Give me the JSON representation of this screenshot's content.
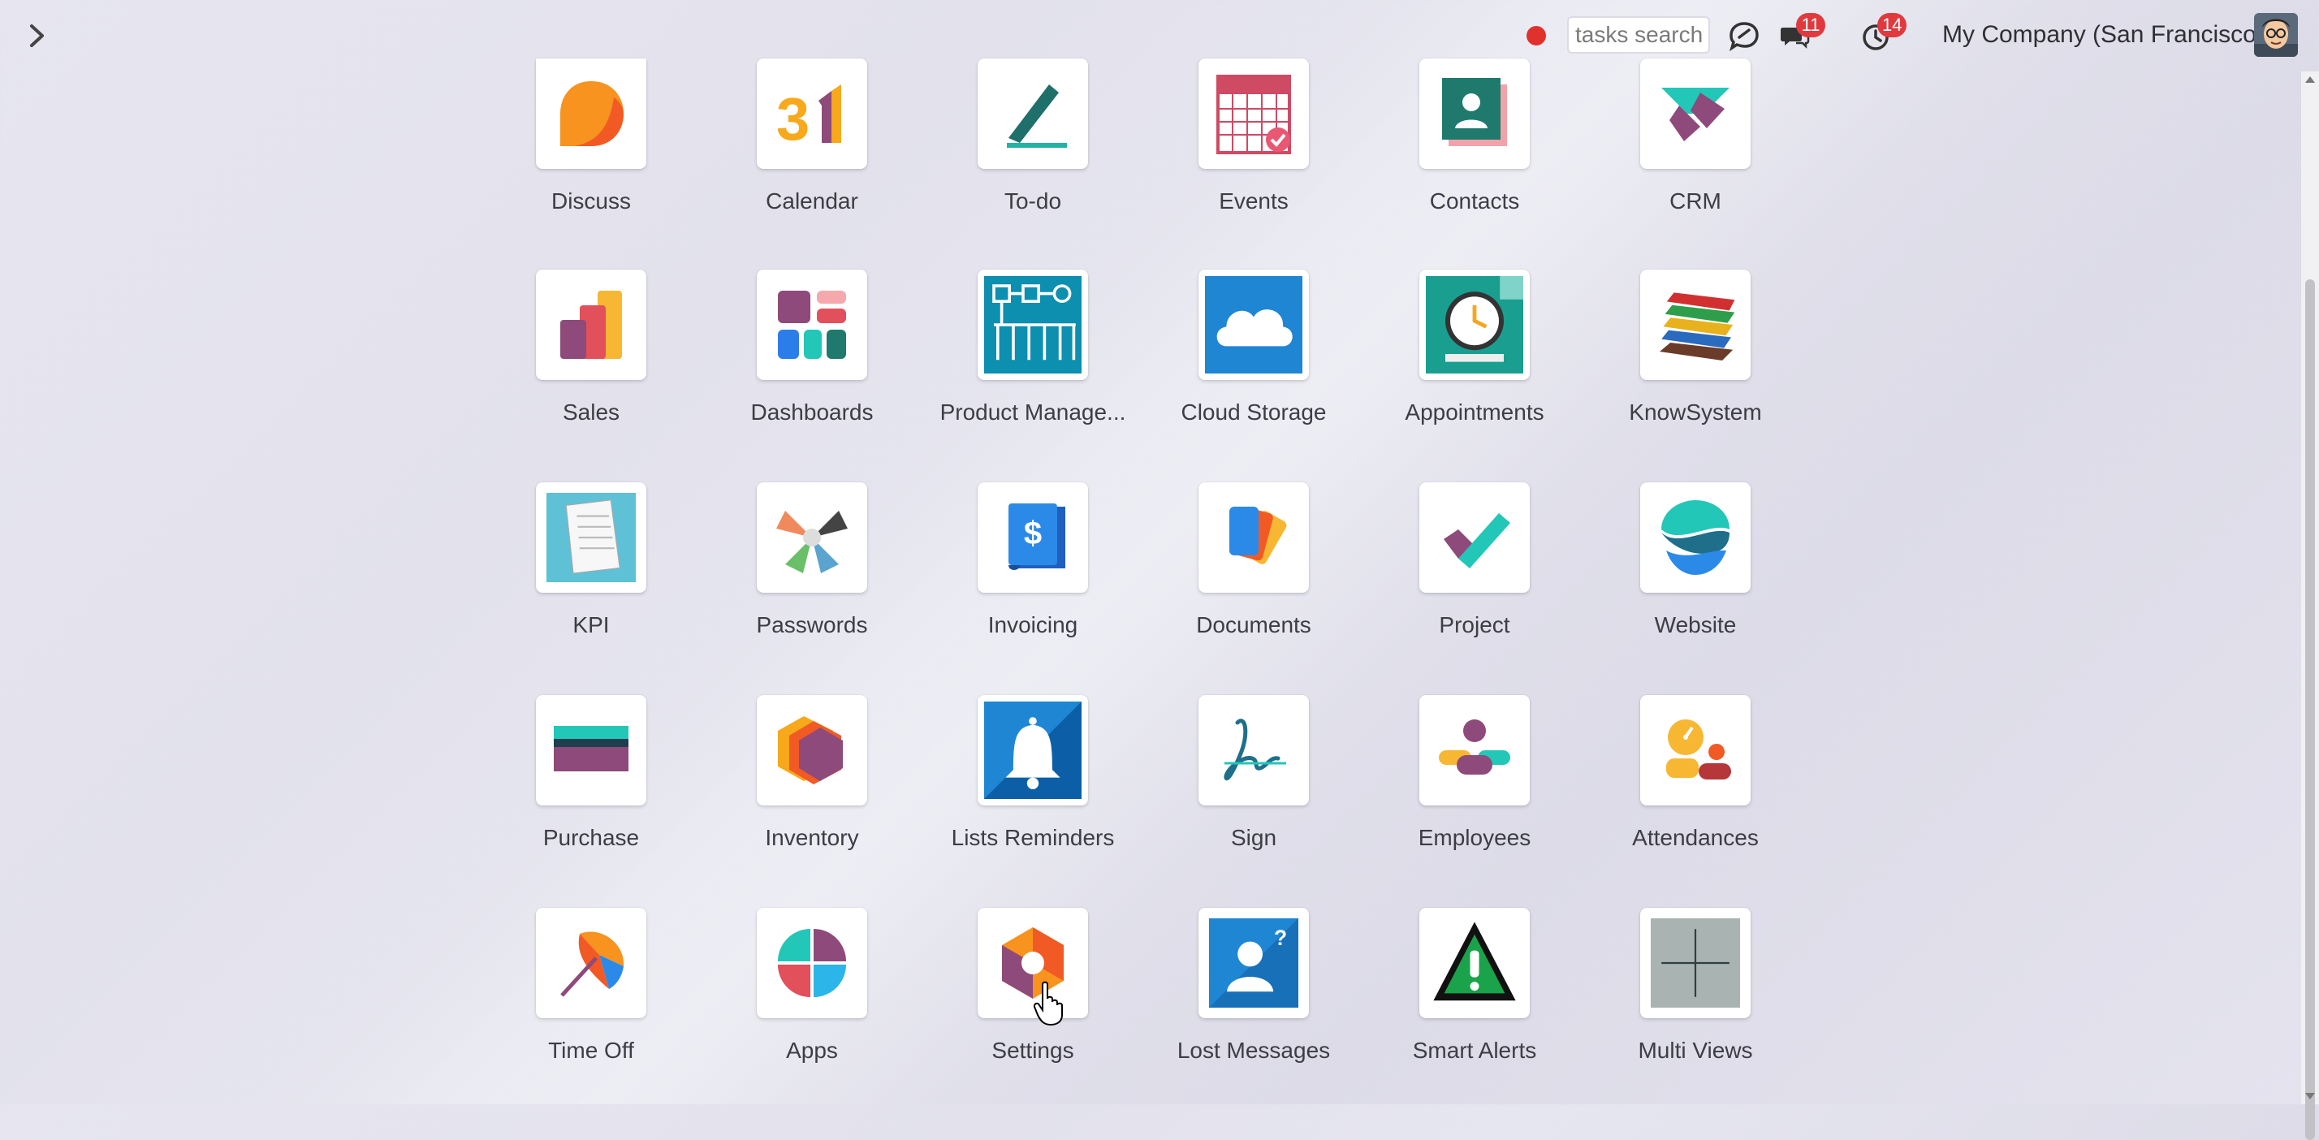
{
  "topbar": {
    "search_placeholder": "tasks search",
    "messages_count": "11",
    "activities_count": "14",
    "company": "My Company (San Francisco)"
  },
  "apps": [
    {
      "label": "Discuss",
      "icon": "discuss-icon"
    },
    {
      "label": "Calendar",
      "icon": "calendar-icon"
    },
    {
      "label": "To-do",
      "icon": "todo-icon"
    },
    {
      "label": "Events",
      "icon": "events-icon"
    },
    {
      "label": "Contacts",
      "icon": "contacts-icon"
    },
    {
      "label": "CRM",
      "icon": "crm-icon"
    },
    {
      "label": "Sales",
      "icon": "sales-icon"
    },
    {
      "label": "Dashboards",
      "icon": "dashboards-icon"
    },
    {
      "label": "Product Manage...",
      "icon": "product-management-icon"
    },
    {
      "label": "Cloud Storage",
      "icon": "cloud-storage-icon"
    },
    {
      "label": "Appointments",
      "icon": "appointments-icon"
    },
    {
      "label": "KnowSystem",
      "icon": "knowsystem-icon"
    },
    {
      "label": "KPI",
      "icon": "kpi-icon"
    },
    {
      "label": "Passwords",
      "icon": "passwords-icon"
    },
    {
      "label": "Invoicing",
      "icon": "invoicing-icon"
    },
    {
      "label": "Documents",
      "icon": "documents-icon"
    },
    {
      "label": "Project",
      "icon": "project-icon"
    },
    {
      "label": "Website",
      "icon": "website-icon"
    },
    {
      "label": "Purchase",
      "icon": "purchase-icon"
    },
    {
      "label": "Inventory",
      "icon": "inventory-icon"
    },
    {
      "label": "Lists Reminders",
      "icon": "lists-reminders-icon"
    },
    {
      "label": "Sign",
      "icon": "sign-icon"
    },
    {
      "label": "Employees",
      "icon": "employees-icon"
    },
    {
      "label": "Attendances",
      "icon": "attendances-icon"
    },
    {
      "label": "Time Off",
      "icon": "time-off-icon"
    },
    {
      "label": "Apps",
      "icon": "apps-icon"
    },
    {
      "label": "Settings",
      "icon": "settings-icon"
    },
    {
      "label": "Lost Messages",
      "icon": "lost-messages-icon"
    },
    {
      "label": "Smart Alerts",
      "icon": "smart-alerts-icon"
    },
    {
      "label": "Multi Views",
      "icon": "multi-views-icon"
    }
  ]
}
